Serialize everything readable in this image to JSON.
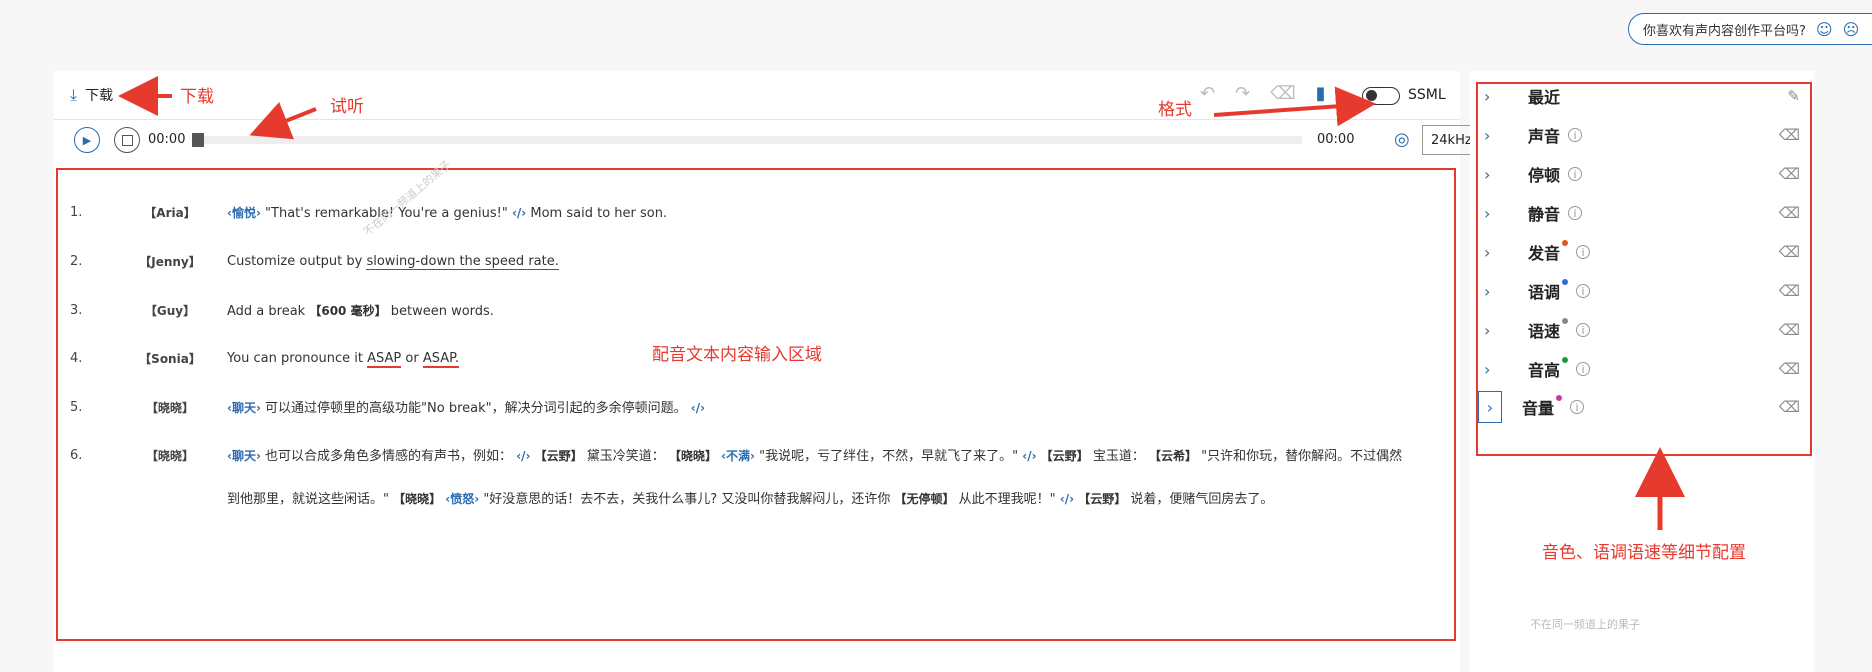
{
  "feedback": {
    "text": "你喜欢有声内容创作平台吗?",
    "face1": "☺",
    "face2": "☹"
  },
  "toolbar": {
    "download_label": "下载",
    "ssml_label": "SSML",
    "time_start": "00:00",
    "time_end": "00:00",
    "sample_rate": "24kHz"
  },
  "lines": [
    {
      "num": "1.",
      "speaker": "【Aria】"
    },
    {
      "num": "2.",
      "speaker": "【Jenny】"
    },
    {
      "num": "3.",
      "speaker": "【Guy】"
    },
    {
      "num": "4.",
      "speaker": "【Sonia】"
    },
    {
      "num": "5.",
      "speaker": "【晓晓】"
    },
    {
      "num": "6.",
      "speaker": "【晓晓】"
    }
  ],
  "text": {
    "l1_tag": "‹愉悦›",
    "l1_text": "\"That's remarkable! You're a genius!\"",
    "l1_end": "‹/›",
    "l1_rest": "Mom said to her son.",
    "l2_a": "Customize output by",
    "l2_b": "slowing-down the speed rate.",
    "l3_a": "Add a break",
    "l3_tag": "【600 毫秒】",
    "l3_b": "between words.",
    "l4_a": "You can pronounce it",
    "l4_b": "ASAP",
    "l4_c": "or",
    "l4_d": "ASAP.",
    "l5_tag": "‹聊天›",
    "l5_text": "可以通过停顿里的高级功能\"No break\"，解决分词引起的多余停顿问题。",
    "l5_end": "‹/›",
    "l6_tag": "‹聊天›",
    "l6_a": "也可以合成多角色多情感的有声书，例如：",
    "l6_end1": "‹/›",
    "l6_sp1": "【云野】",
    "l6_b": "黛玉冷笑道：",
    "l6_sp2": "【晓晓】",
    "l6_tag2": "‹不满›",
    "l6_c": "\"我说呢，亏了绊住，不然，早就飞了来了。\"",
    "l6_end2": "‹/›",
    "l6_sp3": "【云野】",
    "l6_d": "宝玉道：",
    "l6_sp4": "【云希】",
    "l6_e": "\"只许和你玩，替你解闷。不过偶然",
    "l6_f": "到他那里，就说这些闲话。\"",
    "l6_sp5": "【晓晓】",
    "l6_tag3": "‹愤怒›",
    "l6_g": "\"好没意思的话！去不去，关我什么事儿? 又没叫你替我解闷儿，还许你",
    "l6_tag4": "【无停顿】",
    "l6_h": "从此不理我呢！\"",
    "l6_end3": "‹/›",
    "l6_sp6": "【云野】",
    "l6_i": "说着，便赌气回房去了。"
  },
  "watermark": "不在同一频道上的果子",
  "sidebar": {
    "items": [
      {
        "label": "最近",
        "dot": ""
      },
      {
        "label": "声音",
        "dot": ""
      },
      {
        "label": "停顿",
        "dot": ""
      },
      {
        "label": "静音",
        "dot": ""
      },
      {
        "label": "发音",
        "dot": "#e2531f"
      },
      {
        "label": "语调",
        "dot": "#2b6cd8"
      },
      {
        "label": "语速",
        "dot": "#888888"
      },
      {
        "label": "音高",
        "dot": "#1a9b3b"
      },
      {
        "label": "音量",
        "dot": "#c23aa7"
      }
    ],
    "footer": "不在同一频道上的果子"
  },
  "annotations": {
    "download": "下载",
    "listen": "试听",
    "format": "格式",
    "input_area": "配音文本内容输入区域",
    "config": "音色、语调语速等细节配置"
  },
  "colors": {
    "accent": "#2b6cb0",
    "annotation": "#e63a2e"
  }
}
